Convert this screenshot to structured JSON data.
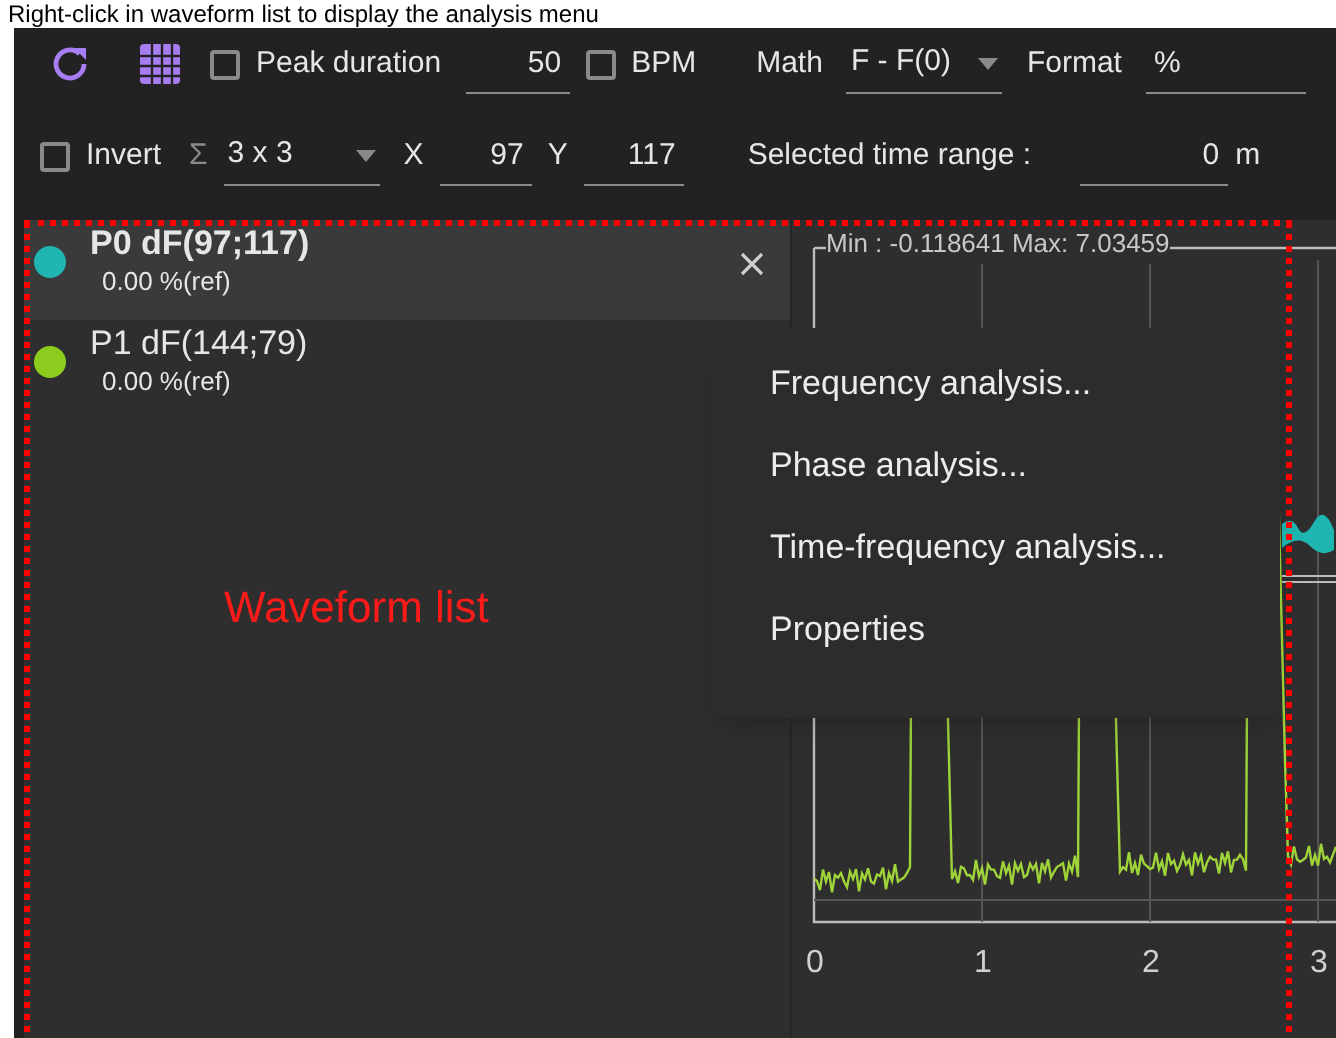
{
  "caption": "Right-click in waveform list to display the analysis menu",
  "toolbar": {
    "peak_duration": {
      "label": "Peak duration",
      "checked": false,
      "value": "50"
    },
    "bpm": {
      "label": "BPM",
      "checked": false
    },
    "math": {
      "label": "Math",
      "value": "F - F(0)"
    },
    "format": {
      "label": "Format",
      "value": "%"
    },
    "invert": {
      "label": "Invert",
      "checked": false
    },
    "binning": {
      "symbol": "Σ",
      "value": "3 x 3"
    },
    "x": {
      "label": "X",
      "value": "97"
    },
    "y": {
      "label": "Y",
      "value": "117"
    },
    "time_range": {
      "label": "Selected time range :",
      "value": "0",
      "unit": "m"
    }
  },
  "waveforms": [
    {
      "name": "P0 dF(97;117)",
      "reading": "0.00 %(ref)",
      "color": "#1fb5b0",
      "selected": true
    },
    {
      "name": "P1 dF(144;79)",
      "reading": "0.00 %(ref)",
      "color": "#8ccc1e",
      "selected": false
    }
  ],
  "chart": {
    "stats": "Min : -0.118641 Max: 7.03459",
    "x_tick_labels": [
      "0",
      "1",
      "2",
      "3"
    ]
  },
  "context_menu": {
    "items": [
      "Frequency analysis...",
      "Phase analysis...",
      "Time-frequency analysis...",
      "Properties"
    ]
  },
  "annotation": {
    "label": "Waveform list"
  }
}
